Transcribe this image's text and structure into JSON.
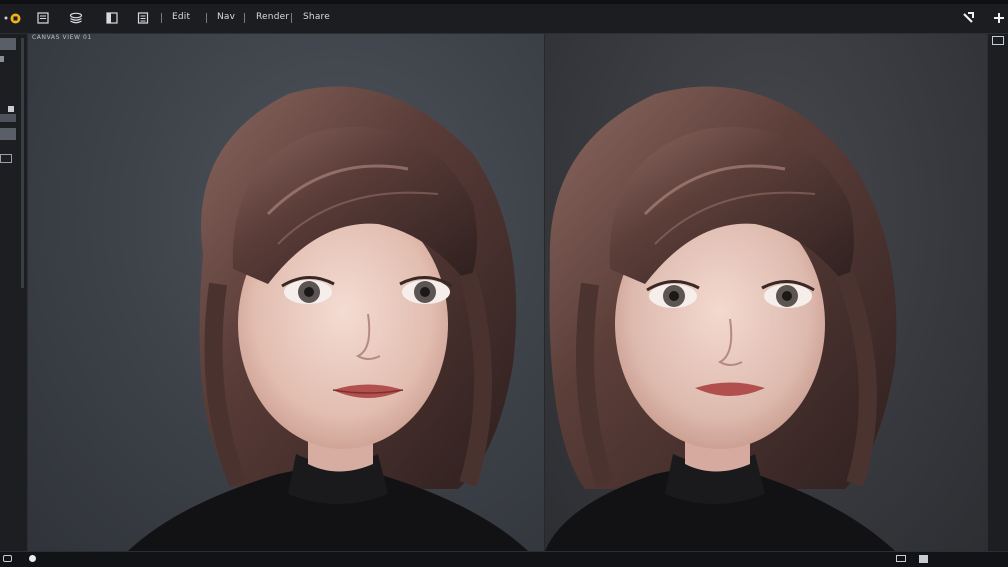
{
  "toolbar": {
    "menus": [
      {
        "label": "Edit"
      },
      {
        "label": "Nav"
      },
      {
        "label": "Render"
      },
      {
        "label": "Share"
      }
    ],
    "left_icons": [
      "logo-badge-icon",
      "file-icon",
      "layers-icon",
      "panel-icon",
      "list-icon"
    ],
    "right_icons": [
      "pick-tool-icon",
      "add-icon"
    ]
  },
  "canvas": {
    "label": "CANVAS VIEW 01",
    "frames": [
      {
        "name": "frame-left",
        "subject": "portrait"
      },
      {
        "name": "frame-right",
        "subject": "portrait"
      }
    ]
  },
  "colors": {
    "accent": "#f2b318",
    "chrome": "#1b1d21",
    "panel": "#1c1e22",
    "background_left": "#3f434a",
    "background_right": "#393b40"
  }
}
